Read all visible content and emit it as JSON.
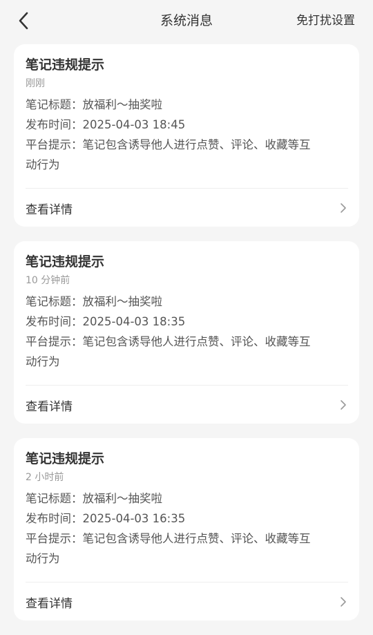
{
  "header": {
    "title": "系统消息",
    "action_label": "免打扰设置",
    "back_icon": "chevron-left-icon"
  },
  "messages": [
    {
      "title": "笔记违规提示",
      "time": "刚刚",
      "note_title": "笔记标题：放福利～抽奖啦",
      "publish_time": "发布时间：2025-04-03 18:45",
      "tip_line1": "平台提示：笔记包含诱导他人进行点赞、评论、收藏等互",
      "tip_line2": "动行为",
      "detail_label": "查看详情"
    },
    {
      "title": "笔记违规提示",
      "time": "10 分钟前",
      "note_title": "笔记标题：放福利～抽奖啦",
      "publish_time": "发布时间：2025-04-03 18:35",
      "tip_line1": "平台提示：笔记包含诱导他人进行点赞、评论、收藏等互",
      "tip_line2": "动行为",
      "detail_label": "查看详情"
    },
    {
      "title": "笔记违规提示",
      "time": "2 小时前",
      "note_title": "笔记标题：放福利～抽奖啦",
      "publish_time": "发布时间：2025-04-03 16:35",
      "tip_line1": "平台提示：笔记包含诱导他人进行点赞、评论、收藏等互",
      "tip_line2": "动行为",
      "detail_label": "查看详情"
    }
  ]
}
